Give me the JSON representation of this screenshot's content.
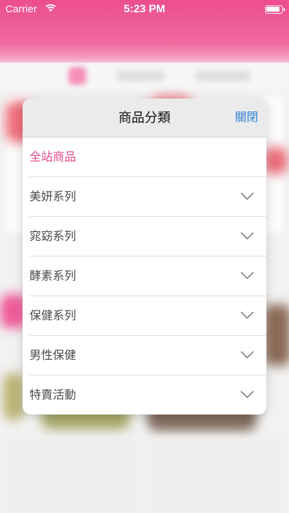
{
  "status_bar": {
    "carrier": "Carrier",
    "time": "5:23 PM"
  },
  "popover": {
    "title": "商品分類",
    "close_label": "關閉",
    "categories": [
      {
        "label": "全站商品",
        "expandable": false,
        "active": true
      },
      {
        "label": "美妍系列",
        "expandable": true,
        "active": false
      },
      {
        "label": "窕窈系列",
        "expandable": true,
        "active": false
      },
      {
        "label": "酵素系列",
        "expandable": true,
        "active": false
      },
      {
        "label": "保健系列",
        "expandable": true,
        "active": false
      },
      {
        "label": "男性保健",
        "expandable": true,
        "active": false
      },
      {
        "label": "特賣活動",
        "expandable": true,
        "active": false
      }
    ]
  },
  "colors": {
    "brand_pink": "#ec4e8e",
    "active_text": "#e64b8c",
    "link_blue": "#2c7fd6",
    "header_gray": "#ebebeb"
  },
  "icons": {
    "expand": "chevron-down-icon",
    "wifi": "wifi-icon",
    "battery": "battery-icon"
  }
}
